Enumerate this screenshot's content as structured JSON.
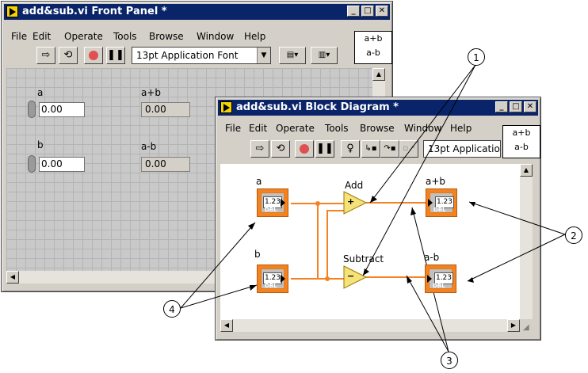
{
  "front_panel": {
    "title": "add&sub.vi Front Panel *",
    "menu": [
      "File",
      "Edit",
      "Operate",
      "Tools",
      "Browse",
      "Window",
      "Help"
    ],
    "font": "13pt Application Font",
    "icon_lines": [
      "a+b",
      "a-b"
    ],
    "controls": [
      {
        "label": "a",
        "value": "0.00"
      },
      {
        "label": "b",
        "value": "0.00"
      }
    ],
    "indicators": [
      {
        "label": "a+b",
        "value": "0.00"
      },
      {
        "label": "a-b",
        "value": "0.00"
      }
    ]
  },
  "block_diagram": {
    "title": "add&sub.vi Block Diagram *",
    "menu": [
      "File",
      "Edit",
      "Operate",
      "Tools",
      "Browse",
      "Window",
      "Help"
    ],
    "font": "13pt Applicatio",
    "icon_lines": [
      "a+b",
      "a-b"
    ],
    "terminals": [
      {
        "label": "a",
        "value": "1.23",
        "type": "DBL"
      },
      {
        "label": "b",
        "value": "1.23",
        "type": "DBL"
      },
      {
        "label": "a+b",
        "value": "1.23",
        "type": "DBL"
      },
      {
        "label": "a-b",
        "value": "1.23",
        "type": "DBL"
      }
    ],
    "nodes": [
      {
        "label": "Add",
        "symbol": "+"
      },
      {
        "label": "Subtract",
        "symbol": "−"
      }
    ]
  },
  "callouts": [
    "1",
    "2",
    "3",
    "4"
  ],
  "colors": {
    "titlebar": "#0a246a",
    "wire": "#f58220",
    "terminal": "#f58220",
    "node": "#f6e27a"
  }
}
